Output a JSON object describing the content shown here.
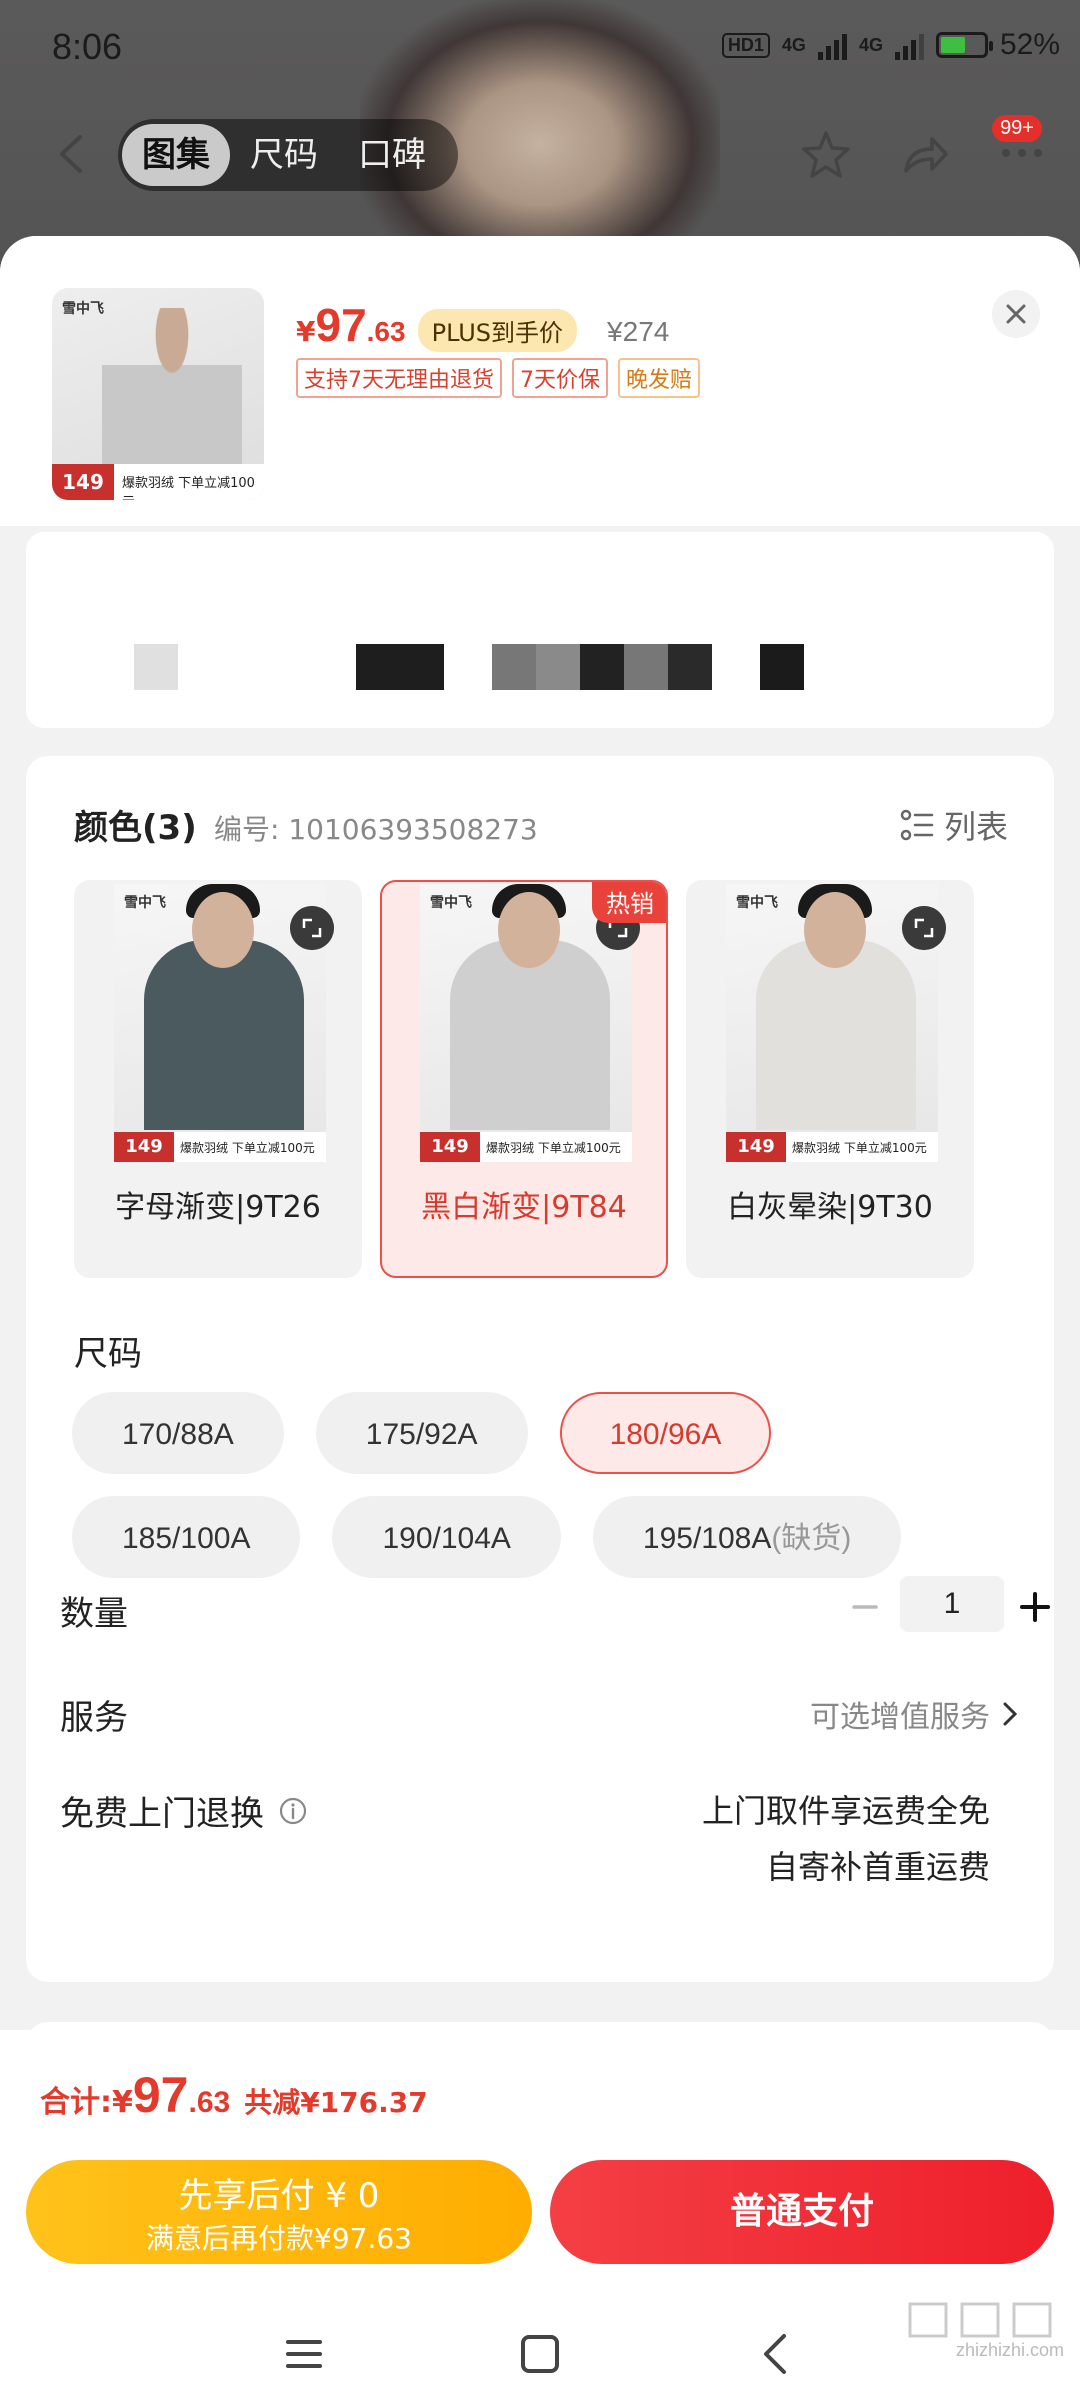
{
  "status": {
    "time": "8:06",
    "network1": "4G",
    "network2": "4G",
    "battery": "52%",
    "hd": "HD1"
  },
  "nav": {
    "tabs": [
      "图集",
      "尺码",
      "口碑"
    ],
    "active_tab": 0,
    "badge": "99+"
  },
  "product": {
    "price_symbol": "¥",
    "price_int": "97",
    "price_dec": ".63",
    "plus_tag": "PLUS到手价",
    "original_price": "¥274",
    "service_tags": [
      "支持7天无理由退货",
      "7天价保",
      "晚发赔"
    ],
    "thumb_logo": "雪中飞",
    "thumb_price": "149",
    "thumb_promo": "爆款羽绒 下单立减100元"
  },
  "color": {
    "title": "颜色(3)",
    "code": "编号: 10106393508273",
    "list_toggle": "列表",
    "hot_badge": "热销",
    "options": [
      {
        "label": "字母渐变|9T26",
        "jacket": "#4a5a5e"
      },
      {
        "label": "黑白渐变|9T84",
        "jacket": "#cfcfcf"
      },
      {
        "label": "白灰晕染|9T30",
        "jacket": "#e2e0dc"
      }
    ],
    "selected": 1,
    "swatch_price": "149",
    "swatch_promo": "爆款羽绒 下单立减100元",
    "swatch_logo": "雪中飞"
  },
  "size": {
    "title": "尺码",
    "rows": [
      [
        "170/88A",
        "175/92A",
        "180/96A"
      ],
      [
        "185/100A",
        "190/104A",
        "195/108A"
      ]
    ],
    "selected": "180/96A",
    "out_of_stock_suffix": "(缺货)"
  },
  "quantity": {
    "label": "数量",
    "value": "1"
  },
  "service": {
    "label": "服务",
    "option_text": "可选增值服务"
  },
  "return": {
    "label": "免费上门退换",
    "line1": "上门取件享运费全免",
    "line2": "自寄补首重运费"
  },
  "bottom": {
    "total_label": "合计:",
    "total_symbol": "¥",
    "total_int": "97",
    "total_dec": ".63",
    "total_save": "共减¥176.37",
    "later_line1": "先享后付 ¥ 0",
    "later_line2": "满意后再付款¥97.63",
    "pay_label": "普通支付"
  },
  "watermark": "zhizhizhi.com",
  "colors": {
    "accent_red": "#e33a2b",
    "pay_red": "#ee1f2a",
    "later_yellow": "#ffb400",
    "plus_bg": "#fde7b1"
  }
}
